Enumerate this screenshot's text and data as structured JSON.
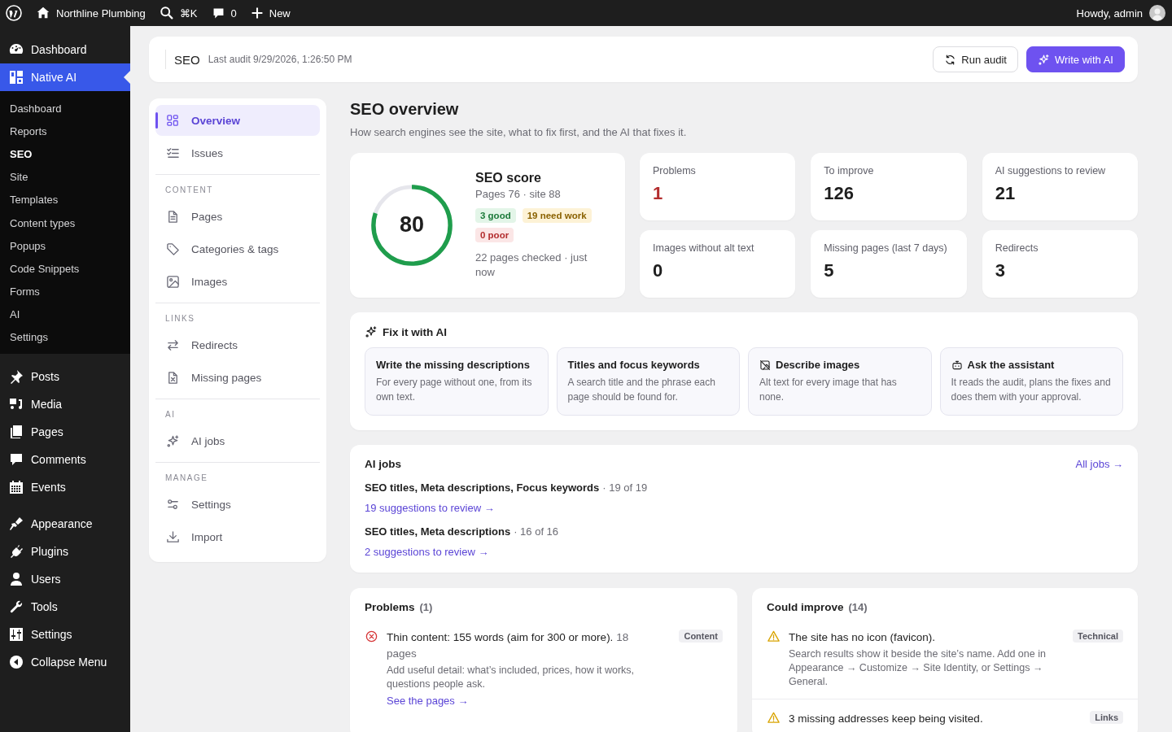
{
  "admin_bar": {
    "site_name": "Northline Plumbing",
    "search_shortcut": "⌘K",
    "comments": "0",
    "new_label": "New",
    "greeting": "Howdy, admin"
  },
  "sidebar": {
    "groups": [
      {
        "items": [
          {
            "label": "Dashboard",
            "selected": false
          },
          {
            "label": "Native AI",
            "selected": true,
            "submenu": [
              {
                "label": "Dashboard",
                "selected": false
              },
              {
                "label": "Reports",
                "selected": false
              },
              {
                "label": "SEO",
                "selected": true
              },
              {
                "label": "Site",
                "selected": false
              },
              {
                "label": "Templates",
                "selected": false
              },
              {
                "label": "Content types",
                "selected": false
              },
              {
                "label": "Popups",
                "selected": false
              },
              {
                "label": "Code Snippets",
                "selected": false
              },
              {
                "label": "Forms",
                "selected": false
              },
              {
                "label": "AI",
                "selected": false
              },
              {
                "label": "Settings",
                "selected": false
              }
            ]
          }
        ]
      },
      {
        "items": [
          {
            "label": "Posts",
            "selected": false
          },
          {
            "label": "Media",
            "selected": false
          },
          {
            "label": "Pages",
            "selected": false
          },
          {
            "label": "Comments",
            "selected": false
          },
          {
            "label": "Events",
            "selected": false
          }
        ]
      },
      {
        "items": [
          {
            "label": "Appearance",
            "selected": false
          },
          {
            "label": "Plugins",
            "selected": false
          },
          {
            "label": "Users",
            "selected": false
          },
          {
            "label": "Tools",
            "selected": false
          },
          {
            "label": "Settings",
            "selected": false
          },
          {
            "label": "Collapse Menu",
            "selected": false
          }
        ]
      }
    ]
  },
  "header": {
    "title": "SEO",
    "subtitle": "Last audit 9/29/2026, 1:26:50 PM",
    "buttons": [
      {
        "label": "Run audit",
        "kind": "secondary"
      },
      {
        "label": "Write with AI",
        "kind": "primary"
      }
    ]
  },
  "subnav": {
    "sections": [
      {
        "items": [
          {
            "label": "Overview",
            "selected": true
          },
          {
            "label": "Issues",
            "selected": false
          }
        ]
      },
      {
        "heading": "CONTENT",
        "items": [
          {
            "label": "Pages",
            "selected": false
          },
          {
            "label": "Categories & tags",
            "selected": false
          },
          {
            "label": "Images",
            "selected": false
          }
        ]
      },
      {
        "heading": "LINKS",
        "items": [
          {
            "label": "Redirects",
            "selected": false
          },
          {
            "label": "Missing pages",
            "selected": false
          }
        ]
      },
      {
        "heading": "AI",
        "items": [
          {
            "label": "AI jobs",
            "selected": false
          }
        ]
      },
      {
        "heading": "MANAGE",
        "items": [
          {
            "label": "Settings",
            "selected": false
          },
          {
            "label": "Import",
            "selected": false
          }
        ]
      }
    ]
  },
  "overview": {
    "title": "SEO overview",
    "description": "How search engines see the site, what to fix first, and the AI that fixes it.",
    "score_card": {
      "title": "SEO score",
      "subtitle": "Pages 76 · site 88",
      "score": "80",
      "level": 0.8,
      "badges": [
        {
          "text": "3 good",
          "kind": "good"
        },
        {
          "text": "19 need work",
          "kind": "warn"
        },
        {
          "text": "0 poor",
          "kind": "poor"
        }
      ],
      "note": "22 pages checked · just now"
    },
    "stats": [
      {
        "label": "Problems",
        "value": "1",
        "alert": true
      },
      {
        "label": "To improve",
        "value": "126",
        "alert": false
      },
      {
        "label": "AI suggestions to review",
        "value": "21",
        "alert": false
      },
      {
        "label": "Images without alt text",
        "value": "0",
        "alert": false
      },
      {
        "label": "Missing pages (last 7 days)",
        "value": "5",
        "alert": false
      },
      {
        "label": "Redirects",
        "value": "3",
        "alert": false
      }
    ]
  },
  "fix_with_ai": {
    "title": "Fix it with AI",
    "cards": [
      {
        "title": "Write the missing descriptions",
        "text": "For every page without one, from its own text."
      },
      {
        "title": "Titles and focus keywords",
        "text": "A search title and the phrase each page should be found for."
      },
      {
        "title": "Describe images",
        "text": "Alt text for every image that has none."
      },
      {
        "title": "Ask the assistant",
        "text": "It reads the audit, plans the fixes and does them with your approval."
      }
    ]
  },
  "ai_jobs": {
    "title": "AI jobs",
    "link": "All jobs →",
    "jobs": [
      {
        "name": "SEO titles, Meta descriptions, Focus keywords",
        "count": "· 19 of 19",
        "link": "19 suggestions to review →"
      },
      {
        "name": "SEO titles, Meta descriptions",
        "count": "· 16 of 16",
        "link": "2 suggestions to review →"
      }
    ]
  },
  "problems": {
    "title": "Problems",
    "count": "(1)",
    "items": [
      {
        "kind": "error",
        "title": "Thin content: 155 words (aim for 300 or more).",
        "meta": "18 pages",
        "detail": "Add useful detail: what’s included, prices, how it works, questions people ask.",
        "link": "See the pages →",
        "tag": "Content"
      }
    ]
  },
  "could_improve": {
    "title": "Could improve",
    "count": "(14)",
    "items": [
      {
        "kind": "warning",
        "title": "The site has no icon (favicon).",
        "detail": "Search results show it beside the site’s name. Add one in Appearance → Customize → Site Identity, or Settings → General.",
        "tag": "Technical"
      },
      {
        "kind": "warning",
        "title": "3 missing addresses keep being visited.",
        "tag": "Links"
      }
    ]
  }
}
